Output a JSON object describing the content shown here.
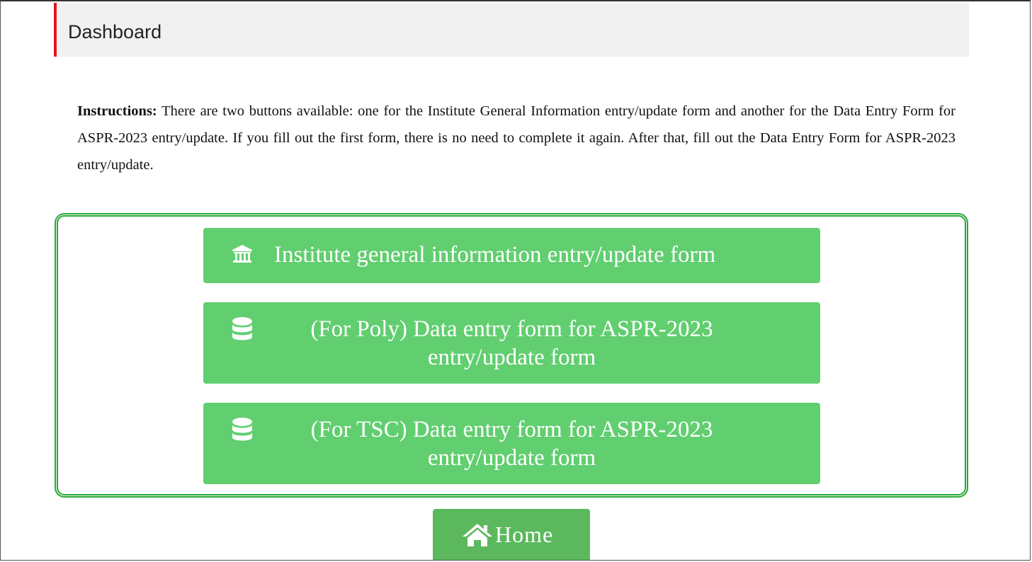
{
  "header": {
    "title": "Dashboard",
    "accent_color": "#e3141c"
  },
  "instructions": {
    "label": "Instructions:",
    "text": " There are two buttons available: one for the Institute General Information entry/update form and another for the Data Entry Form for ASPR-2023 entry/update. If you fill out the first form, there is no need to complete it again. After that, fill out the Data Entry Form for ASPR-2023 entry/update."
  },
  "forms": {
    "border_color": "#2aa836",
    "button_color": "#61ce70",
    "buttons": [
      {
        "icon": "institution-icon",
        "lines": [
          "Institute general information entry/update form"
        ]
      },
      {
        "icon": "database-icon",
        "lines": [
          "(For Poly) Data entry form for ASPR-2023",
          "entry/update form"
        ]
      },
      {
        "icon": "database-icon",
        "lines": [
          "(For TSC) Data entry form for ASPR-2023",
          "entry/update form"
        ]
      }
    ]
  },
  "home": {
    "icon": "home-icon",
    "label": "Home",
    "color": "#5cb85c"
  }
}
